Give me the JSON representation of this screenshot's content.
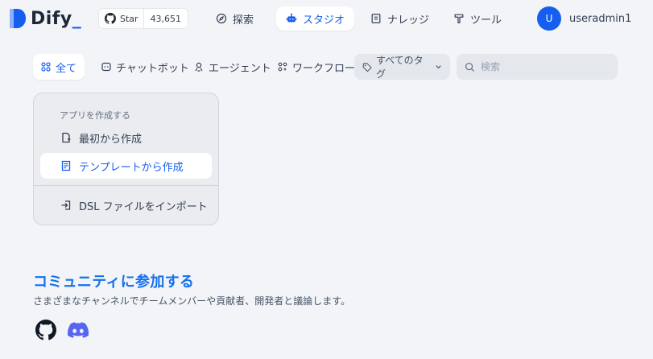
{
  "app": {
    "logo_text": "Dify",
    "logo_suffix": "_"
  },
  "github": {
    "label": "Star",
    "count": "43,651"
  },
  "nav": [
    {
      "label": "探索",
      "icon": "compass-icon"
    },
    {
      "label": "スタジオ",
      "icon": "robot-icon",
      "active": true
    },
    {
      "label": "ナレッジ",
      "icon": "book-icon"
    },
    {
      "label": "ツール",
      "icon": "hammer-icon"
    }
  ],
  "user": {
    "initial": "U",
    "name": "useradmin1"
  },
  "filters": {
    "tabs": [
      {
        "label": "全て",
        "icon": "grid-icon",
        "active": true
      },
      {
        "label": "チャットボット",
        "icon": "chat-icon"
      },
      {
        "label": "エージェント",
        "icon": "agent-icon"
      },
      {
        "label": "ワークフロー",
        "icon": "workflow-icon"
      }
    ],
    "tag_select": "すべてのタグ",
    "search_placeholder": "検索"
  },
  "create_card": {
    "heading": "アプリを作成する",
    "items": [
      {
        "label": "最初から作成",
        "icon": "file-plus-icon"
      },
      {
        "label": "テンプレートから作成",
        "icon": "template-icon",
        "highlight": true
      },
      {
        "label": "DSL ファイルをインポート",
        "icon": "import-icon"
      }
    ]
  },
  "community": {
    "title": "コミュニティに参加する",
    "description": "さまざまなチャンネルでチームメンバーや貢献者、開発者と議論します。"
  },
  "colors": {
    "accent": "#155eef",
    "community_title": "#1570ef",
    "background": "#f2f4f7"
  }
}
